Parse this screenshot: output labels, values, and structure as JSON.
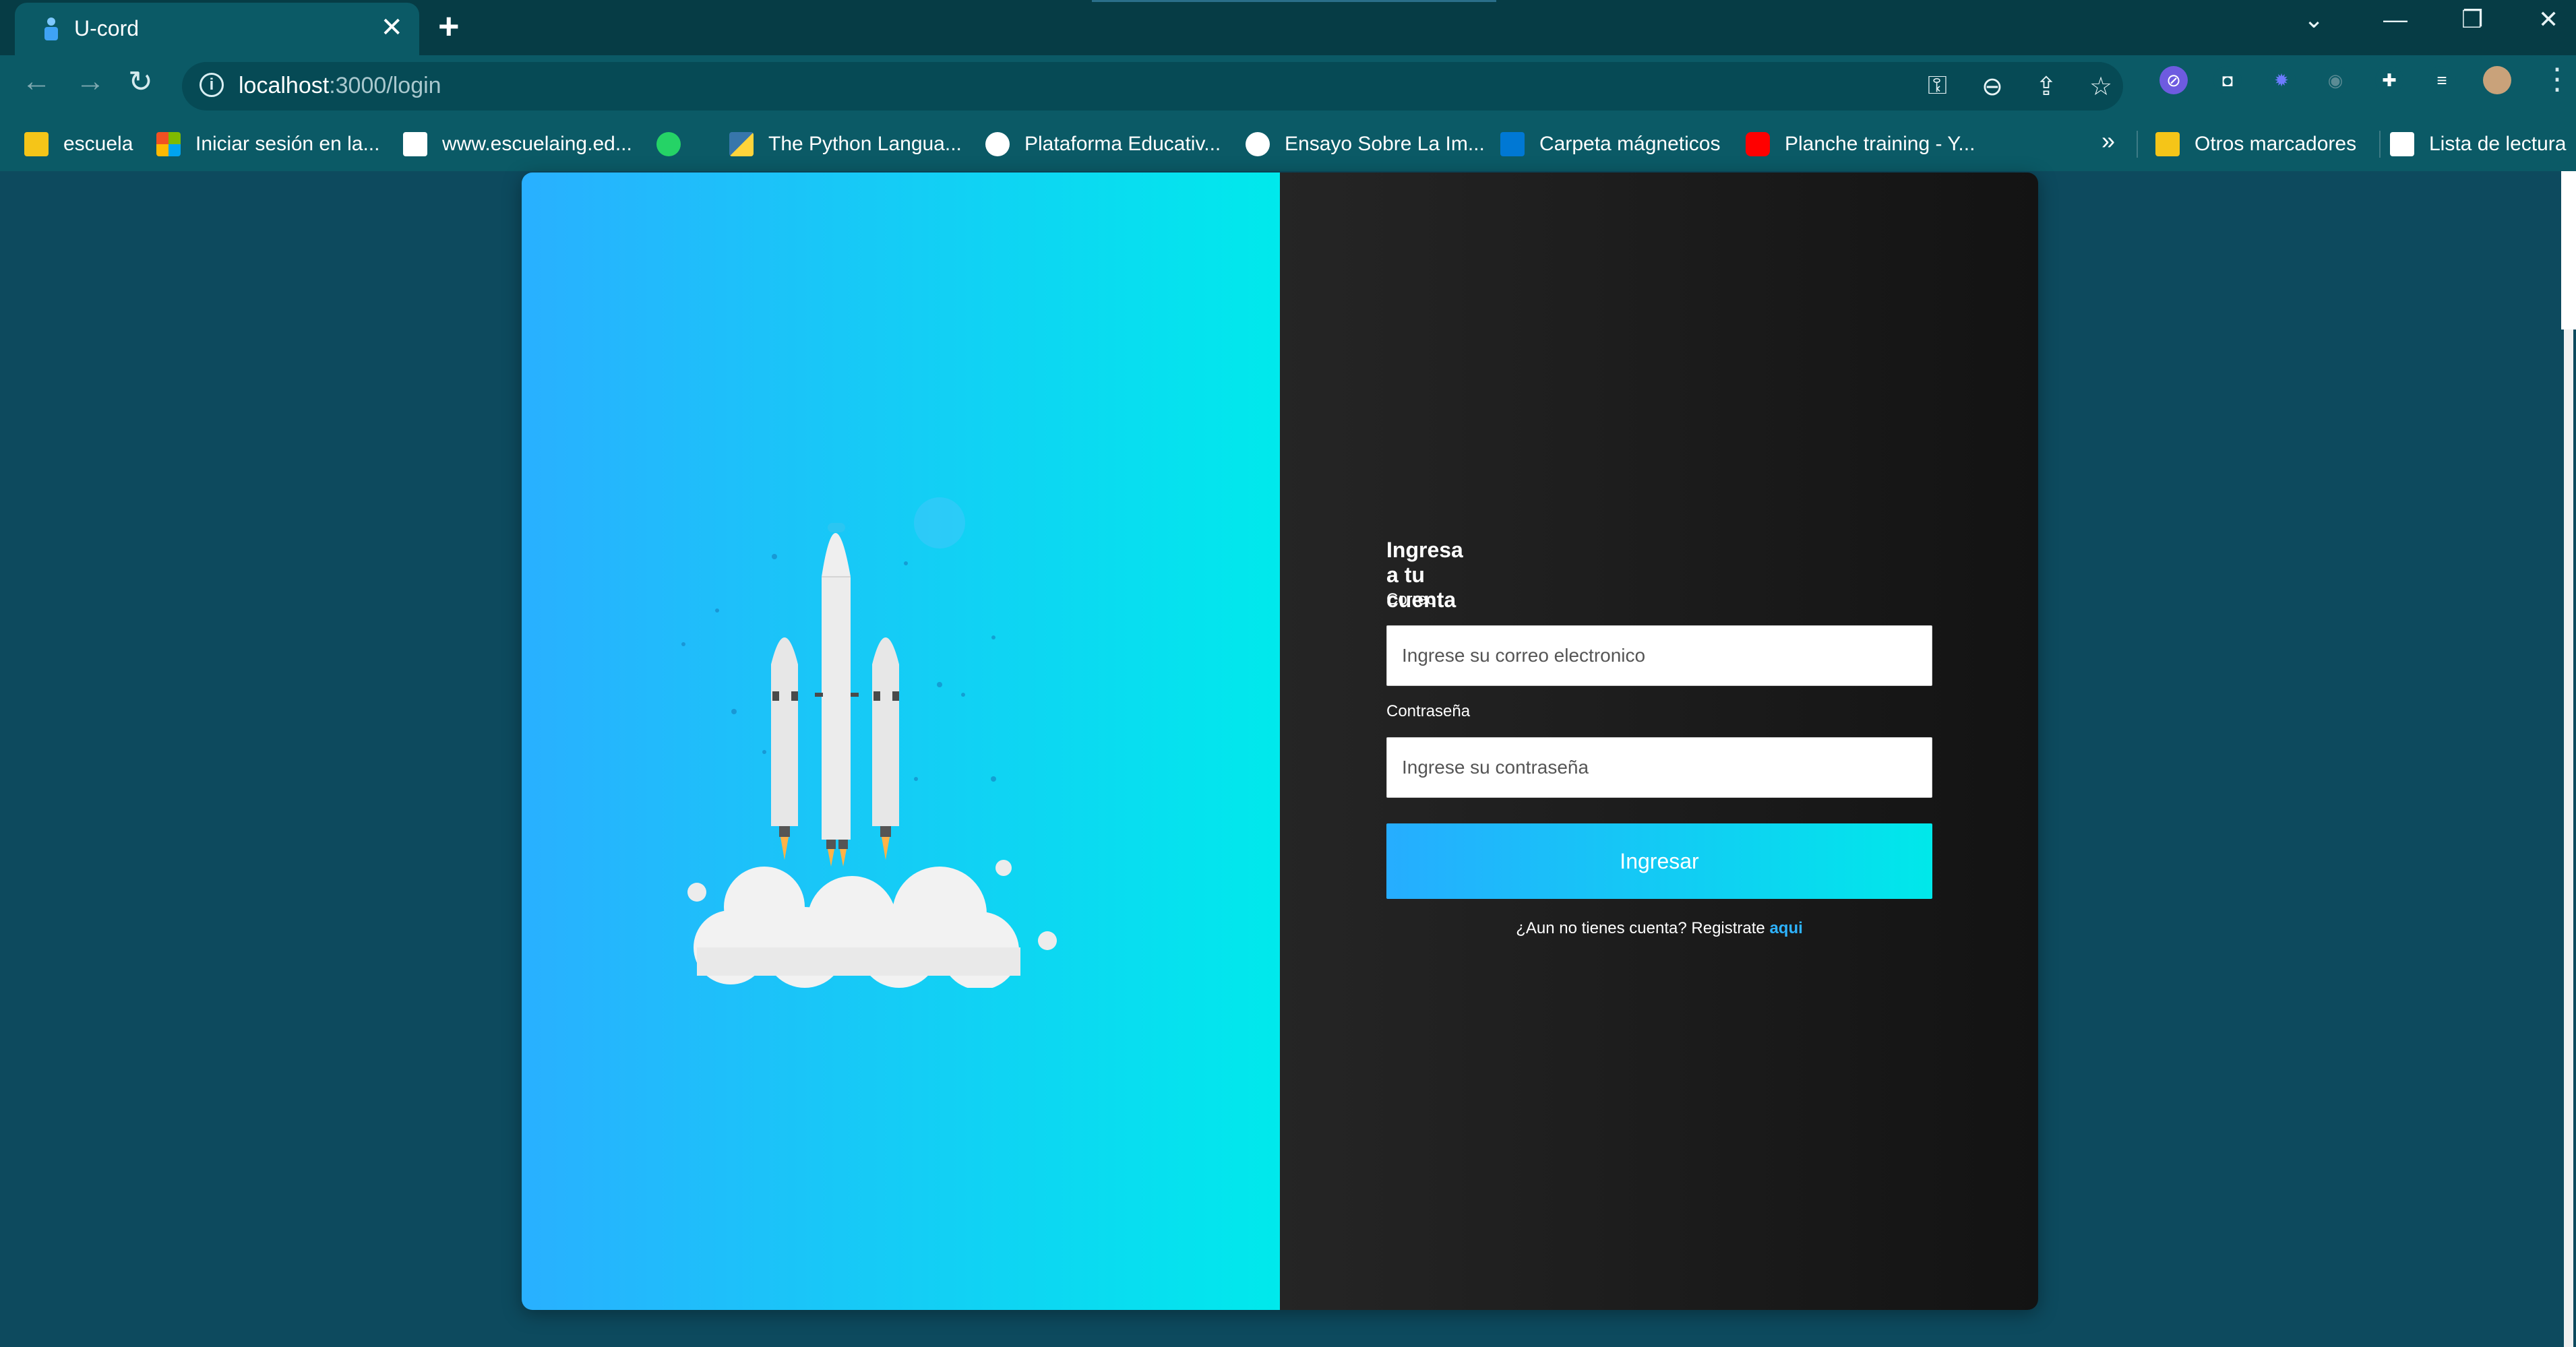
{
  "browser": {
    "tab_title": "U-cord",
    "tab_close": "✕",
    "new_tab": "+",
    "address": {
      "host": "localhost",
      "path": ":3000/login"
    }
  },
  "bookmarks": [
    {
      "label": "escuela",
      "icon": "folder-icon",
      "color": "#f5c518"
    },
    {
      "label": "Iniciar sesión en la...",
      "icon": "microsoft-icon",
      "color": "#f25022"
    },
    {
      "label": "www.escuelaing.ed...",
      "icon": "page-icon",
      "color": "#ffffff"
    },
    {
      "label": "",
      "icon": "whatsapp-icon",
      "color": "#25d366"
    },
    {
      "label": "The Python Langua...",
      "icon": "python-icon",
      "color": "#3776ab"
    },
    {
      "label": "Plataforma Educativ...",
      "icon": "globe-icon",
      "color": "#ffffff"
    },
    {
      "label": "Ensayo Sobre La Im...",
      "icon": "scribd-icon",
      "color": "#ffffff"
    },
    {
      "label": "Carpeta mágneticos",
      "icon": "outlook-icon",
      "color": "#0078d4"
    },
    {
      "label": "Planche training - Y...",
      "icon": "youtube-icon",
      "color": "#ff0000"
    }
  ],
  "bookmarks_more": "»",
  "bookmarks_right": [
    {
      "label": "Otros marcadores",
      "icon": "folder-icon",
      "color": "#f5c518"
    },
    {
      "label": "Lista de lectura",
      "icon": "reading-list-icon",
      "color": "#ffffff"
    }
  ],
  "login": {
    "title": "Ingresa a tu cuenta",
    "email_label": "Correo",
    "email_placeholder": "Ingrese su correo electronico",
    "password_label": "Contraseña",
    "password_placeholder": "Ingrese su contraseña",
    "submit": "Ingresar",
    "signup_prompt": "¿Aun no tienes cuenta? Registrate ",
    "signup_link": "aqui"
  },
  "colors": {
    "accent": "#29b0ff",
    "accent_end": "#00e9ec",
    "page_bg": "#0d4a5e"
  }
}
